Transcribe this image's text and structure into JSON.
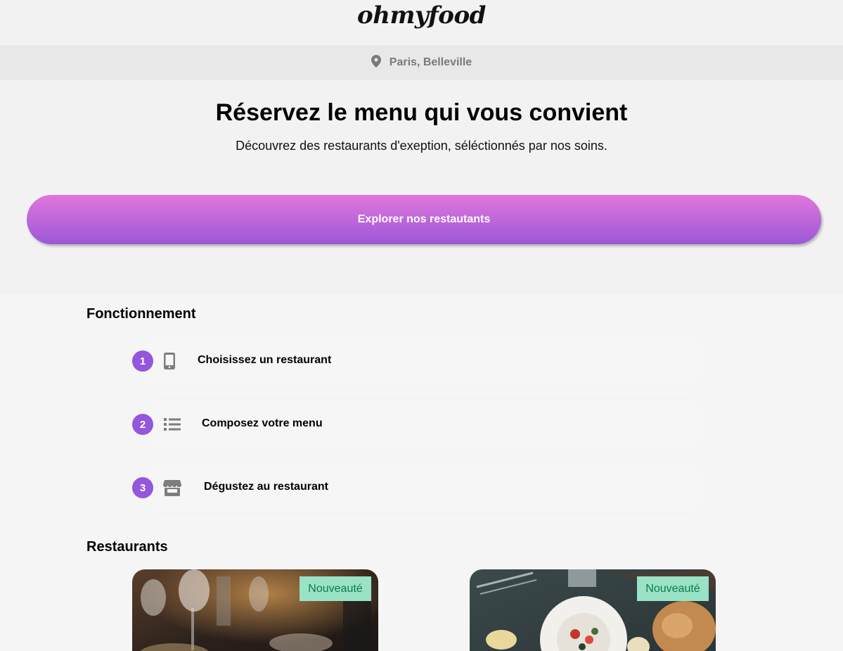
{
  "header": {
    "logo": "ohmyfood"
  },
  "location": {
    "icon": "map-pin-icon",
    "text": "Paris, Belleville"
  },
  "hero": {
    "title": "Réservez le menu qui vous convient",
    "subtitle": "Découvrez des restaurants d'exeption, séléctionnés par nos soins.",
    "cta_label": "Explorer nos restautants"
  },
  "how_it_works": {
    "title": "Fonctionnement",
    "steps": [
      {
        "number": "1",
        "icon": "smartphone-icon",
        "label": "Choisissez un restaurant"
      },
      {
        "number": "2",
        "icon": "list-icon",
        "label": "Composez votre menu"
      },
      {
        "number": "3",
        "icon": "store-icon",
        "label": "Dégustez au restaurant"
      }
    ]
  },
  "restaurants": {
    "title": "Restaurants",
    "cards": [
      {
        "badge": "Nouveauté"
      },
      {
        "badge": "Nouveauté"
      }
    ]
  },
  "colors": {
    "accent_purple": "#9356dc",
    "gradient_top": "#e276dc",
    "gradient_bottom": "#9b58d8",
    "badge_bg": "#99e2c6",
    "badge_text": "#0d7a4a"
  }
}
